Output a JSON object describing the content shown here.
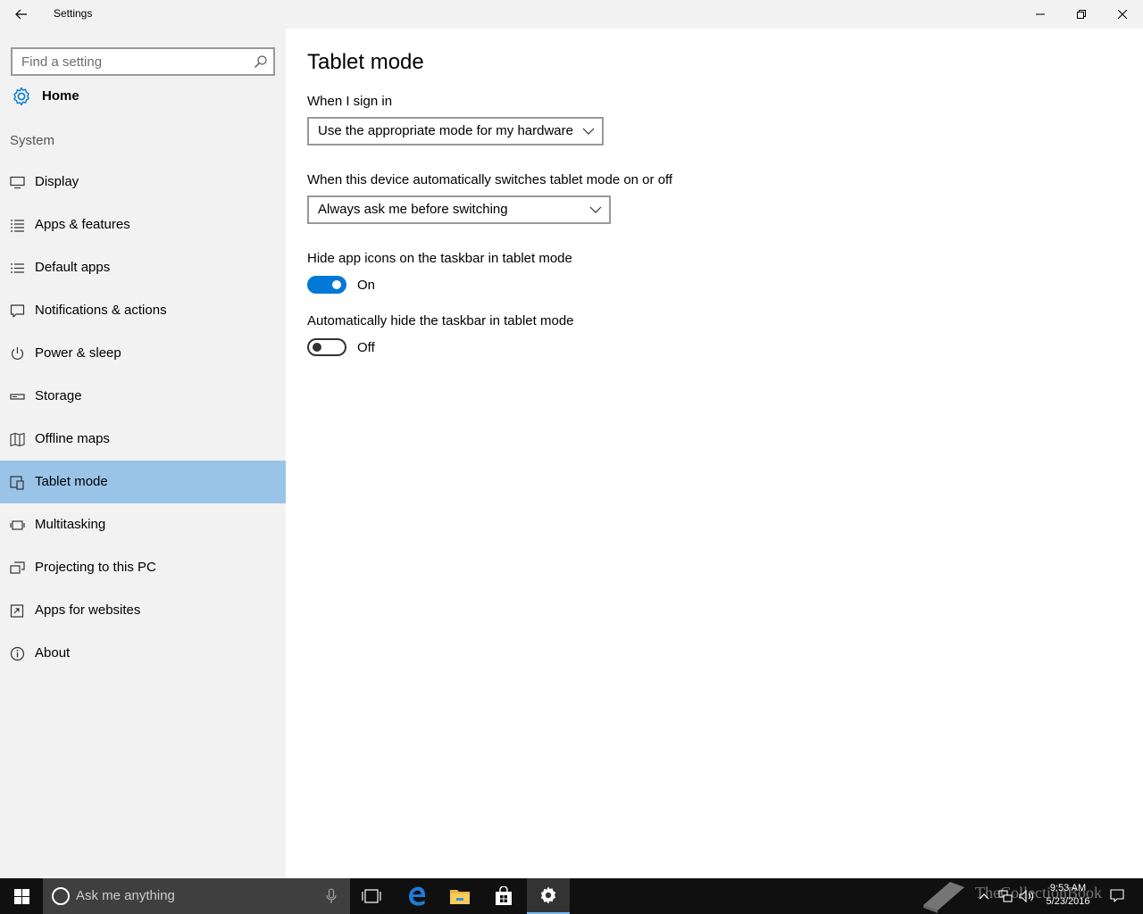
{
  "window": {
    "title": "Settings"
  },
  "sidebar": {
    "search_placeholder": "Find a setting",
    "home_label": "Home",
    "group_label": "System",
    "items": [
      {
        "label": "Display",
        "icon": "monitor-icon"
      },
      {
        "label": "Apps & features",
        "icon": "list-icon"
      },
      {
        "label": "Default apps",
        "icon": "list-icon"
      },
      {
        "label": "Notifications & actions",
        "icon": "speech-bubble-icon"
      },
      {
        "label": "Power & sleep",
        "icon": "power-icon"
      },
      {
        "label": "Storage",
        "icon": "drive-icon"
      },
      {
        "label": "Offline maps",
        "icon": "map-icon"
      },
      {
        "label": "Tablet mode",
        "icon": "tablet-mode-icon",
        "selected": true
      },
      {
        "label": "Multitasking",
        "icon": "multitasking-icon"
      },
      {
        "label": "Projecting to this PC",
        "icon": "projecting-icon"
      },
      {
        "label": "Apps for websites",
        "icon": "app-link-icon"
      },
      {
        "label": "About",
        "icon": "info-icon"
      }
    ]
  },
  "main": {
    "title": "Tablet mode",
    "sign_in": {
      "label": "When I sign in",
      "value": "Use the appropriate mode for my hardware"
    },
    "auto_switch": {
      "label": "When this device automatically switches tablet mode on or off",
      "value": "Always ask me before switching"
    },
    "hide_icons": {
      "label": "Hide app icons on the taskbar in tablet mode",
      "state": "On"
    },
    "hide_taskbar": {
      "label": "Automatically hide the taskbar in tablet mode",
      "state": "Off"
    }
  },
  "taskbar": {
    "search_placeholder": "Ask me anything",
    "time": "9:53 AM",
    "date": "5/23/2016",
    "watermark": "TheCollectionBook"
  },
  "colors": {
    "accent": "#0078d7",
    "selected_nav": "#99c4e8",
    "sidebar_bg": "#f2f2f2",
    "taskbar_bg": "#101010"
  }
}
